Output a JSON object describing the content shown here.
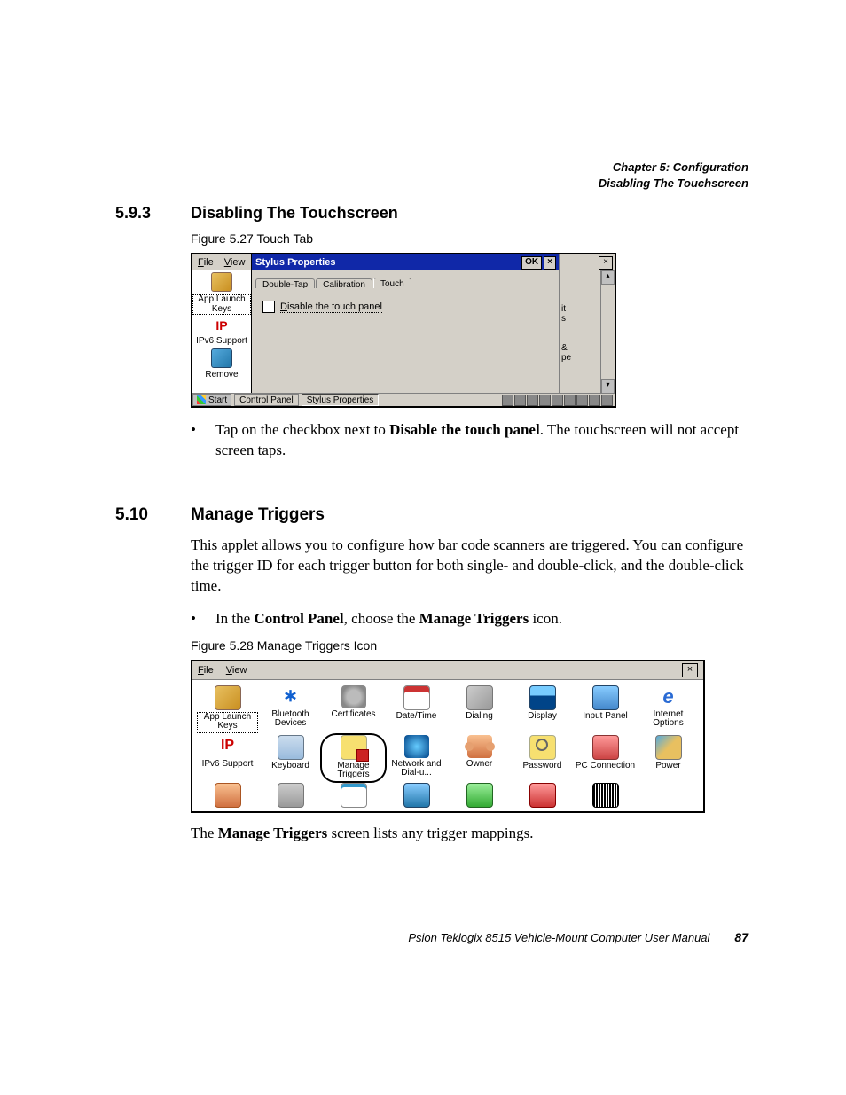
{
  "header": {
    "chapter": "Chapter 5: Configuration",
    "section": "Disabling The Touchscreen"
  },
  "sec593": {
    "num": "5.9.3",
    "title": "Disabling The Touchscreen"
  },
  "fig527": {
    "caption": "Figure 5.27 Touch Tab"
  },
  "shot1": {
    "menu_file": "File",
    "menu_view": "View",
    "title": "Stylus Properties",
    "ok": "OK",
    "close": "×",
    "tabs": {
      "t1": "Double-Tap",
      "t2": "Calibration",
      "t3": "Touch"
    },
    "checkbox": "Disable the touch panel",
    "left": {
      "i1": "App Launch Keys",
      "i2": "IPv6 Support",
      "i3": "Remove"
    },
    "rfrag": {
      "a": "it",
      "b": "s",
      "c": "&",
      "d": "pe"
    },
    "taskbar": {
      "start": "Start",
      "t1": "Control Panel",
      "t2": "Stylus Properties"
    }
  },
  "bullet1a": "Tap on the checkbox next to ",
  "bullet1b": "Disable the touch panel",
  "bullet1c": ". The touchscreen will not accept screen taps.",
  "sec510": {
    "num": "5.10",
    "title": "Manage Triggers"
  },
  "para510": "This applet allows you to configure how bar code scanners are triggered. You can configure the trigger ID for each trigger button for both single- and double-click, and the double-click time.",
  "bullet2a": "In the ",
  "bullet2b": "Control Panel",
  "bullet2c": ", choose the ",
  "bullet2d": "Manage Triggers",
  "bullet2e": " icon.",
  "fig528": {
    "caption": "Figure 5.28 Manage Triggers Icon"
  },
  "shot2": {
    "menu_file": "File",
    "menu_view": "View",
    "close": "×",
    "items": {
      "c0": "App Launch Keys",
      "c1": "Bluetooth Devices",
      "c2": "Certificates",
      "c3": "Date/Time",
      "c4": "Dialing",
      "c5": "Display",
      "c6": "Input Panel",
      "c7": "Internet Options",
      "c8": "IPv6 Support",
      "c9": "Keyboard",
      "c10": "Manage Triggers",
      "c11": "Network and Dial-u...",
      "c12": "Owner",
      "c13": "Password",
      "c14": "PC Connection",
      "c15": "Power"
    }
  },
  "tail": {
    "a": "The ",
    "b": "Manage Triggers",
    "c": " screen lists any trigger mappings."
  },
  "footer": {
    "text": "Psion Teklogix 8515 Vehicle-Mount Computer User Manual",
    "page": "87"
  }
}
